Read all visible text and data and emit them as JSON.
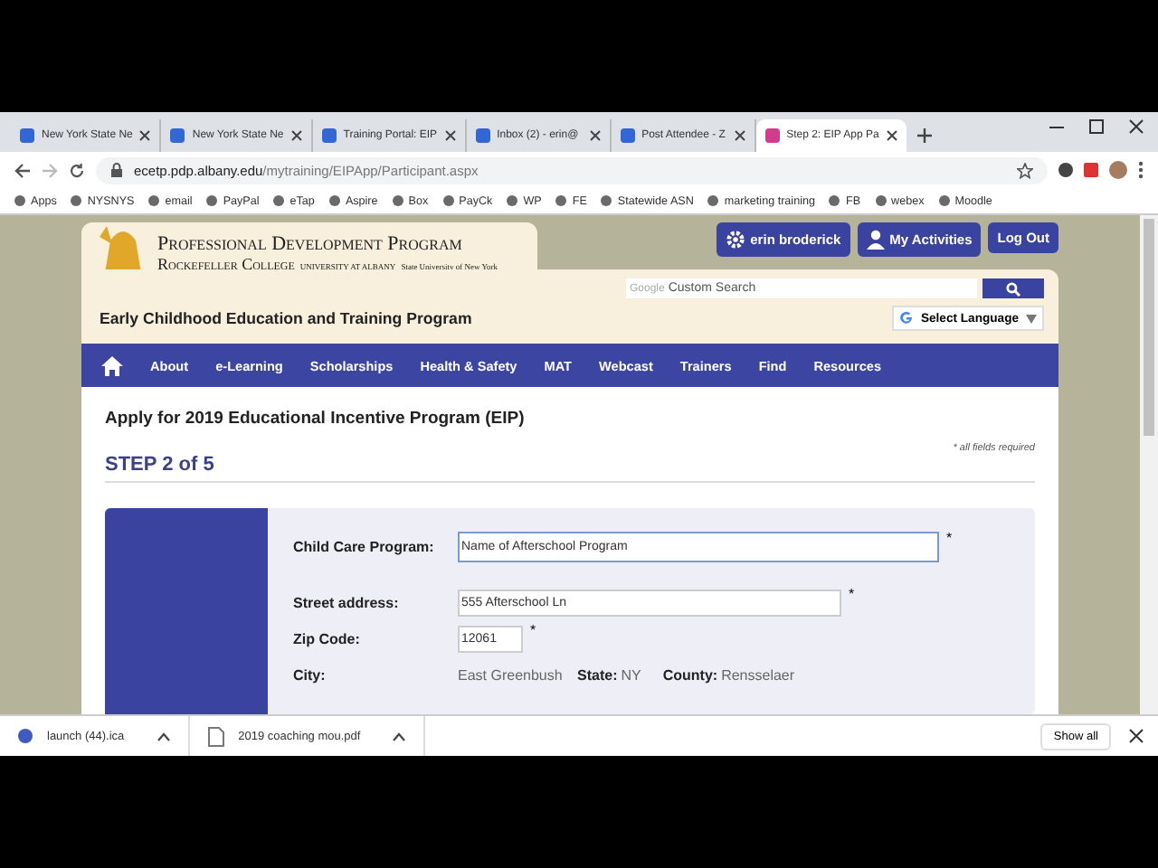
{
  "browser": {
    "tabs": [
      {
        "label": "New York State Ne",
        "selected": false
      },
      {
        "label": "New York State Ne",
        "selected": false
      },
      {
        "label": "Training Portal: EIP",
        "selected": false
      },
      {
        "label": "Inbox (2) - erin@",
        "selected": false
      },
      {
        "label": "Post Attendee - Z",
        "selected": false
      },
      {
        "label": "Step 2: EIP App Pa",
        "selected": true
      }
    ],
    "url_host": "ecetp.pdp.albany.edu",
    "url_path": "/mytraining/EIPApp/Participant.aspx",
    "bookmarks": [
      "Apps",
      "NYSNYS",
      "email",
      "PayPal",
      "eTap",
      "Aspire",
      "Box",
      "PayCk",
      "WP",
      "FE",
      "Statewide ASN",
      "marketing training",
      "FB",
      "webex",
      "Moodle"
    ]
  },
  "site": {
    "logo_line1": "Professional Development Program",
    "logo_line2": "Rockefeller College",
    "logo_line3": "UNIVERSITY AT ALBANY",
    "logo_line4": "State University of New York",
    "user_buttons": [
      "erin broderick",
      "My Activities",
      "Log Out"
    ],
    "search_brand": "Google",
    "search_placeholder": "Custom Search",
    "program_title": "Early Childhood Education and Training Program",
    "language": "Select Language",
    "nav": [
      "About",
      "e-Learning",
      "Scholarships",
      "Health & Safety",
      "MAT",
      "Webcast",
      "Trainers",
      "Find",
      "Resources"
    ]
  },
  "form": {
    "title": "Apply for 2019 Educational Incentive Program (EIP)",
    "required_note": "* all fields required",
    "step": "STEP 2 of 5",
    "fields": [
      {
        "label": "Child Care Program:",
        "value": "Name of Afterschool Program",
        "mark": "*",
        "focused": true
      },
      {
        "label": "Street address:",
        "value": "555 Afterschool Ln",
        "mark": "*",
        "focused": false
      },
      {
        "label": "Zip Code:",
        "value": "12061",
        "mark": "*",
        "focused": false
      }
    ],
    "city_label": "City:",
    "city": "East Greenbush",
    "state_label": "State:",
    "state": "NY",
    "county_label": "County:",
    "county": "Rensselaer"
  },
  "downloads": {
    "items": [
      "launch (44).ica",
      "2019 coaching mou.pdf"
    ],
    "show_all": "Show all"
  }
}
